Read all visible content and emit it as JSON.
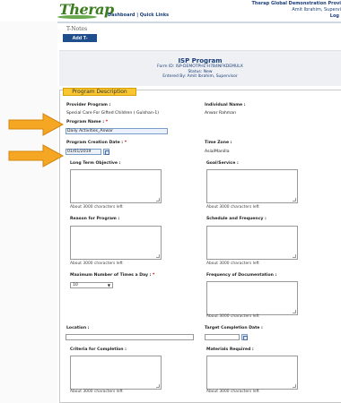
{
  "app": {
    "logo": "Therap",
    "nav_links": "Dashboard | Quick Links",
    "agency_name": "Therap Global Demonstration Provi",
    "user": "Amit Ibrahim, Supervi",
    "logout": "Log"
  },
  "page": {
    "tnotes": "T-Notes",
    "add_button": "Add T-Note"
  },
  "header": {
    "title": "ISP Program",
    "form_id": "Form ID: ISP-DEMOTPHL-H7B4NFKDEMULX",
    "status": "Status: New",
    "entered_by": "Entered By: Amit Ibrahim, Supervisor"
  },
  "section": {
    "legend": "Program Description"
  },
  "fields": {
    "provider_program_label": "Provider Program :",
    "provider_program_value": "Special Care For Gifted Children ( Gulshan-1)",
    "individual_name_label": "Individual Name :",
    "individual_name_value": "Anwar Rahman",
    "program_name_label": "Program Name :",
    "program_name_value": "Daily Activities_Anwar",
    "creation_date_label": "Program Creation Date :",
    "creation_date_value": "01/01/2019",
    "time_zone_label": "Time Zone :",
    "time_zone_value": "Asia/Manilla",
    "long_term_label": "Long Term Objective :",
    "goal_label": "Goal/Service :",
    "reason_label": "Reason for Program :",
    "schedule_label": "Schedule and Frequency :",
    "max_times_label": "Maximum Number of Times a Day :",
    "max_times_value": "10",
    "freq_doc_label": "Frequency of Documentation :",
    "location_label": "Location :",
    "target_date_label": "Target Completion Date :",
    "criteria_label": "Criteria for Completion :",
    "materials_label": "Materials Required :",
    "required_mark": "*",
    "chars_left": "About 3000 characters left"
  },
  "colors": {
    "accent": "#1f4e8c",
    "legend": "#f9c631",
    "arrow": "#f5a623"
  }
}
